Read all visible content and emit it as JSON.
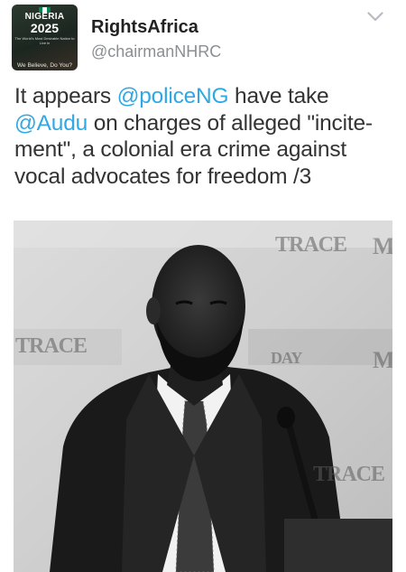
{
  "account": {
    "display_name": "RightsAfrica",
    "handle": "@chairmanNHRC",
    "avatar": {
      "line1": "NIGERIA",
      "line2": "2025",
      "line3": "The World's Most Desirable Nation to Live in",
      "line4": "We Believe, Do You?",
      "flag_colors": [
        "#008751",
        "#ffffff",
        "#008751"
      ]
    }
  },
  "menu": {
    "icon": "chevron-down-icon"
  },
  "tweet": {
    "part1": "It appears ",
    "mention1": "@policeNG",
    "part2": " have take ",
    "mention2": "@Audu",
    "part3": " on charges of alleged \"incite- ment\", a colonial era crime against vocal advocates for freedom /3"
  },
  "photo": {
    "watermarks": [
      "TRACE",
      "TRACE",
      "M",
      "M",
      "DAY",
      "TRACE"
    ]
  },
  "colors": {
    "mention": "#2fa8e6",
    "text": "#333333",
    "handle": "#8a8f94"
  }
}
